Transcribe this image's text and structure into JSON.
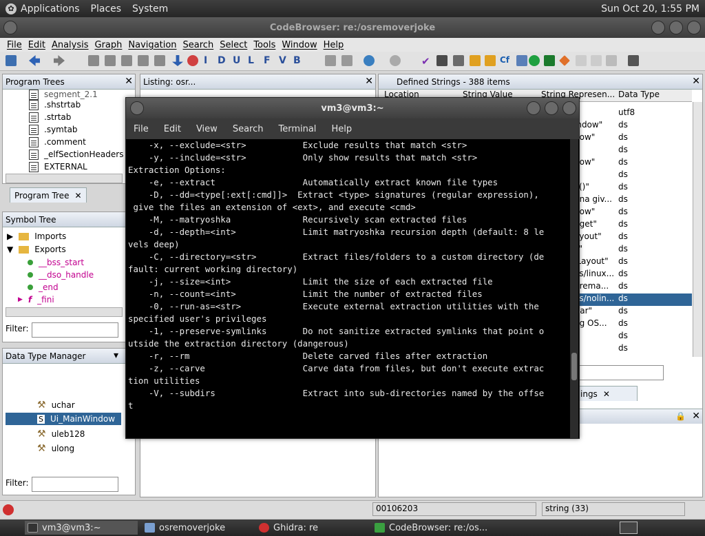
{
  "top_panel": {
    "applications": "Applications",
    "places": "Places",
    "system": "System",
    "clock": "Sun Oct 20,  1:55 PM"
  },
  "codebrowser": {
    "title": "CodeBrowser: re:/osremoverjoke",
    "menu": [
      "File",
      "Edit",
      "Analysis",
      "Graph",
      "Navigation",
      "Search",
      "Select",
      "Tools",
      "Window",
      "Help"
    ]
  },
  "program_trees": {
    "header": "Program Trees",
    "items": [
      ".shstrtab",
      ".strtab",
      ".symtab",
      ".comment",
      "_elfSectionHeaders",
      "EXTERNAL"
    ],
    "partial_item": "segment_2.1",
    "tab": "Program Tree"
  },
  "symbol_tree": {
    "header": "Symbol Tree",
    "imports": "Imports",
    "exports": "Exports",
    "export_items": [
      "__bss_start",
      "__dso_handle",
      "_end",
      "_fini"
    ],
    "filter_label": "Filter:"
  },
  "data_type_manager": {
    "header": "Data Type Manager",
    "items": [
      "uchar",
      "Ui_MainWindow",
      "uleb128",
      "ulong"
    ],
    "filter_label": "Filter:"
  },
  "listing": {
    "header": "Listing:  osr..."
  },
  "defined_strings": {
    "header": "Defined Strings - 388 items",
    "columns": [
      "Location",
      "String Value",
      "String Represen...",
      "Data Type"
    ],
    "rows": [
      {
        "rep": "",
        "type": "utf8"
      },
      {
        "rep": "indow\"",
        "type": "ds"
      },
      {
        "rep": "dow\"",
        "type": "ds"
      },
      {
        "rep": "",
        "type": "ds"
      },
      {
        "rep": "dow\"",
        "type": "ds"
      },
      {
        "rep": "\"",
        "type": "ds"
      },
      {
        "rep": "k()\"",
        "type": "ds"
      },
      {
        "rep": "nna giv...",
        "type": "ds"
      },
      {
        "rep": "dow\"",
        "type": "ds"
      },
      {
        "rep": "dget\"",
        "type": "ds"
      },
      {
        "rep": "ayout\"",
        "type": "ds"
      },
      {
        "rep": "ll\"",
        "type": "ds"
      },
      {
        "rep": "lLayout\"",
        "type": "ds"
      },
      {
        "rep": "es/linux...",
        "type": "ds"
      },
      {
        "rep": "prema...",
        "type": "ds"
      },
      {
        "rep": "es/nolin...",
        "type": "ds"
      },
      {
        "rep": "Bar\"",
        "type": "ds"
      },
      {
        "rep": "ng OS...",
        "type": "ds"
      },
      {
        "rep": "",
        "type": "ds"
      },
      {
        "rep": "",
        "type": "ds"
      }
    ],
    "tab": "ings"
  },
  "status": {
    "address": "00106203",
    "value": "string (33)"
  },
  "terminal": {
    "title": "vm3@vm3:~",
    "menu": [
      "File",
      "Edit",
      "View",
      "Search",
      "Terminal",
      "Help"
    ],
    "lines": [
      "    -x, --exclude=<str>           Exclude results that match <str>",
      "    -y, --include=<str>           Only show results that match <str>",
      "",
      "Extraction Options:",
      "    -e, --extract                 Automatically extract known file types",
      "    -D, --dd=<type[:ext[:cmd]]>  Extract <type> signatures (regular expression),",
      " give the files an extension of <ext>, and execute <cmd>",
      "    -M, --matryoshka              Recursively scan extracted files",
      "    -d, --depth=<int>             Limit matryoshka recursion depth (default: 8 le",
      "vels deep)",
      "    -C, --directory=<str>         Extract files/folders to a custom directory (de",
      "fault: current working directory)",
      "    -j, --size=<int>              Limit the size of each extracted file",
      "    -n, --count=<int>             Limit the number of extracted files",
      "    -0, --run-as=<str>            Execute external extraction utilities with the",
      "specified user's privileges",
      "    -1, --preserve-symlinks       Do not sanitize extracted symlinks that point o",
      "utside the extraction directory (dangerous)",
      "    -r, --rm                      Delete carved files after extraction",
      "    -z, --carve                   Carve data from files, but don't execute extrac",
      "tion utilities",
      "    -V, --subdirs                 Extract into sub-directories named by the offse",
      "t"
    ]
  },
  "taskbar": {
    "items": [
      "vm3@vm3:~",
      "osremoverjoke",
      "Ghidra: re",
      "CodeBrowser: re:/os..."
    ]
  }
}
